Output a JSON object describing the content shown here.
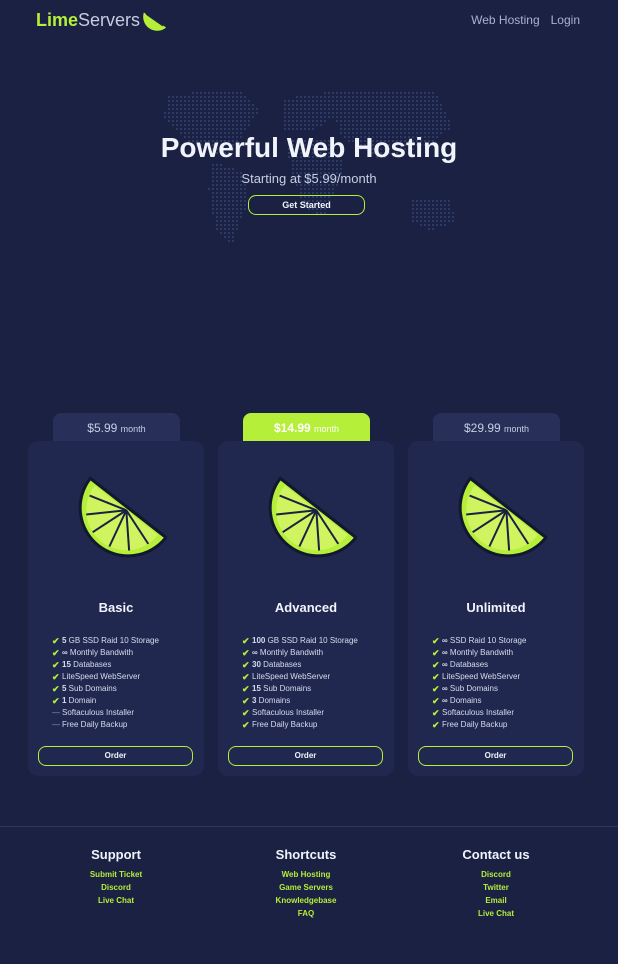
{
  "nav": {
    "logo_lime": "Lime",
    "logo_rest": "Servers",
    "links": [
      "Web Hosting",
      "Login"
    ]
  },
  "hero": {
    "title": "Powerful Web Hosting",
    "subtitle": "Starting at $5.99/month",
    "button": "Get Started"
  },
  "plans": [
    {
      "price": "$5.99",
      "unit": "month",
      "name": "Basic",
      "featured": false,
      "features": [
        {
          "icon": "check-icon",
          "bold": "5",
          "text": " GB SSD Raid 10 Storage"
        },
        {
          "icon": "check-icon",
          "bold": "∞",
          "text": " Monthly Bandwith"
        },
        {
          "icon": "check-icon",
          "bold": "15",
          "text": " Databases"
        },
        {
          "icon": "check-icon",
          "bold": "",
          "text": "LiteSpeed WebServer"
        },
        {
          "icon": "check-icon",
          "bold": "5",
          "text": " Sub Domains"
        },
        {
          "icon": "check-icon",
          "bold": "1",
          "text": " Domain"
        },
        {
          "icon": "dash-icon",
          "bold": "",
          "text": "Softaculous Installer"
        },
        {
          "icon": "dash-icon",
          "bold": "",
          "text": "Free Daily Backup"
        }
      ],
      "button": "Order"
    },
    {
      "price": "$14.99",
      "unit": "month",
      "name": "Advanced",
      "featured": true,
      "features": [
        {
          "icon": "check-icon",
          "bold": "100",
          "text": " GB SSD Raid 10 Storage"
        },
        {
          "icon": "check-icon",
          "bold": "∞",
          "text": " Monthly Bandwith"
        },
        {
          "icon": "check-icon",
          "bold": "30",
          "text": " Databases"
        },
        {
          "icon": "check-icon",
          "bold": "",
          "text": "LiteSpeed WebServer"
        },
        {
          "icon": "check-icon",
          "bold": "15",
          "text": " Sub Domains"
        },
        {
          "icon": "check-icon",
          "bold": "3",
          "text": " Domains"
        },
        {
          "icon": "check-icon",
          "bold": "",
          "text": "Softaculous Installer"
        },
        {
          "icon": "check-icon",
          "bold": "",
          "text": "Free Daily Backup"
        }
      ],
      "button": "Order"
    },
    {
      "price": "$29.99",
      "unit": "month",
      "name": "Unlimited",
      "featured": false,
      "features": [
        {
          "icon": "check-icon",
          "bold": "∞",
          "text": " SSD Raid 10 Storage"
        },
        {
          "icon": "check-icon",
          "bold": "∞",
          "text": " Monthly Bandwith"
        },
        {
          "icon": "check-icon",
          "bold": "∞",
          "text": " Databases"
        },
        {
          "icon": "check-icon",
          "bold": "",
          "text": "LiteSpeed WebServer"
        },
        {
          "icon": "check-icon",
          "bold": "∞",
          "text": " Sub Domains"
        },
        {
          "icon": "check-icon",
          "bold": "∞",
          "text": " Domains"
        },
        {
          "icon": "check-icon",
          "bold": "",
          "text": "Softaculous Installer"
        },
        {
          "icon": "check-icon",
          "bold": "",
          "text": "Free Daily Backup"
        }
      ],
      "button": "Order"
    }
  ],
  "footer": {
    "columns": [
      {
        "title": "Support",
        "links": [
          "Submit Ticket",
          "Discord",
          "Live Chat"
        ]
      },
      {
        "title": "Shortcuts",
        "links": [
          "Web Hosting",
          "Game Servers",
          "Knowledgebase",
          "FAQ"
        ]
      },
      {
        "title": "Contact us",
        "links": [
          "Discord",
          "Twitter",
          "Email",
          "Live Chat"
        ]
      }
    ]
  },
  "colors": {
    "background": "#1a2142",
    "card": "#212850",
    "accent_lime": "#b6ef3a"
  }
}
